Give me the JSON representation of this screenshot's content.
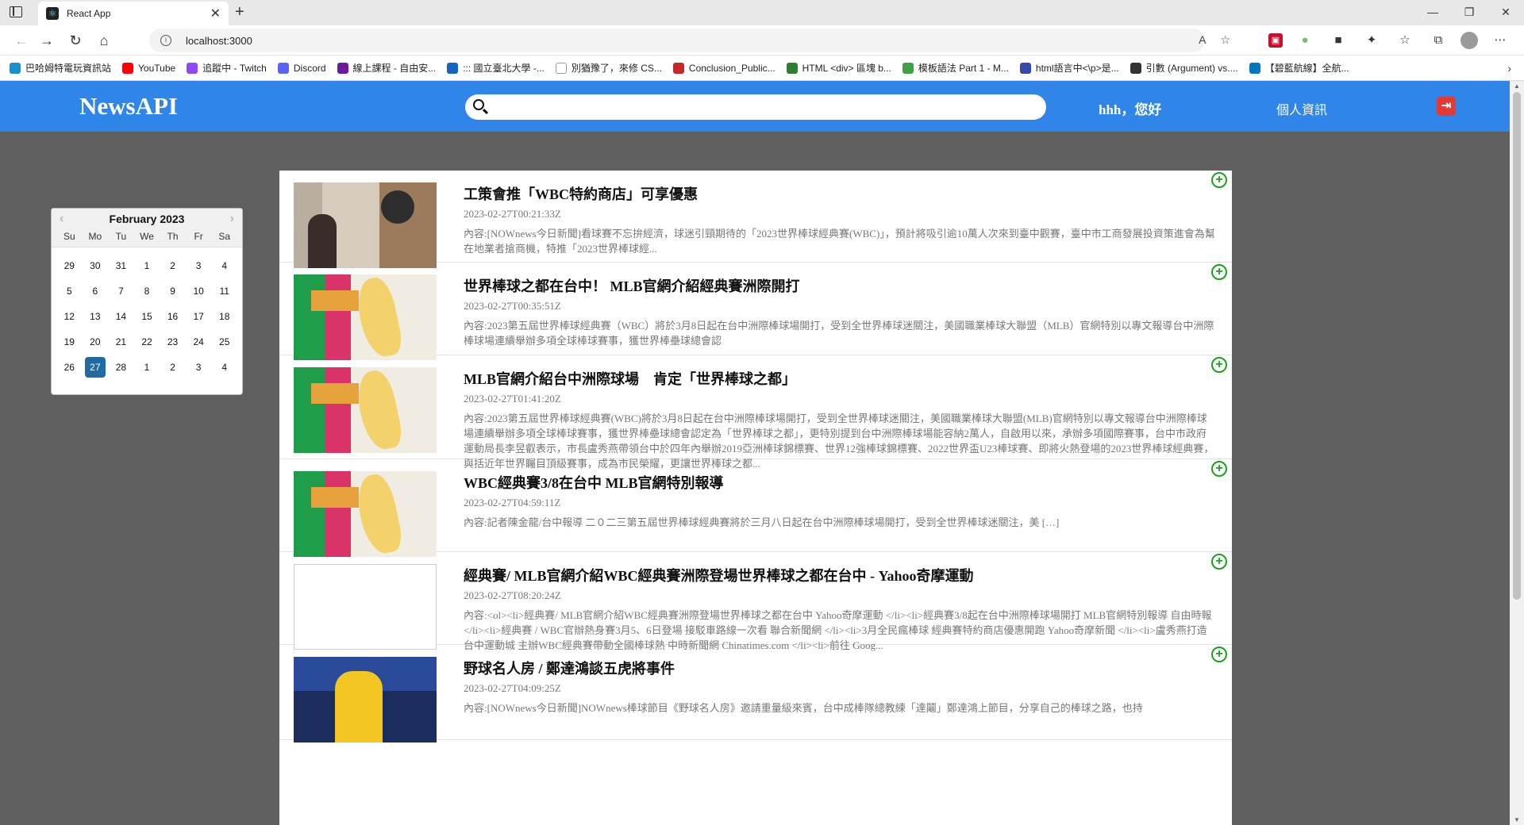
{
  "browser": {
    "tab_title": "React App",
    "url": "localhost:3000",
    "bookmarks": [
      {
        "label": "巴哈姆特電玩資訊站",
        "color": "#1a8fc8"
      },
      {
        "label": "YouTube",
        "color": "#ff0000"
      },
      {
        "label": "追蹤中 - Twitch",
        "color": "#9146ff"
      },
      {
        "label": "Discord",
        "color": "#5865f2"
      },
      {
        "label": "線上課程 - 自由安...",
        "color": "#6a1b9a"
      },
      {
        "label": "::: 國立臺北大學 -...",
        "color": "#1565c0"
      },
      {
        "label": "別猶豫了，來修 CS...",
        "color": "#ffffff"
      },
      {
        "label": "Conclusion_Public...",
        "color": "#c62828"
      },
      {
        "label": "HTML <div> 區塊 b...",
        "color": "#2e7d32"
      },
      {
        "label": "模板語法 Part 1 - M...",
        "color": "#43a047"
      },
      {
        "label": "html語言中<\\p>是...",
        "color": "#3949ab"
      },
      {
        "label": "引數 (Argument) vs....",
        "color": "#333333"
      },
      {
        "label": "【碧藍航線】全航...",
        "color": "#0277bd"
      }
    ]
  },
  "header": {
    "brand": "NewsAPI",
    "search_placeholder": "",
    "greeting": "hhh，您好",
    "profile_link": "個人資訊"
  },
  "calendar": {
    "month_label": "February 2023",
    "weekdays": [
      "Su",
      "Mo",
      "Tu",
      "We",
      "Th",
      "Fr",
      "Sa"
    ],
    "days": [
      "29",
      "30",
      "31",
      "1",
      "2",
      "3",
      "4",
      "5",
      "6",
      "7",
      "8",
      "9",
      "10",
      "11",
      "12",
      "13",
      "14",
      "15",
      "16",
      "17",
      "18",
      "19",
      "20",
      "21",
      "22",
      "23",
      "24",
      "25",
      "26",
      "27",
      "28",
      "1",
      "2",
      "3",
      "4"
    ],
    "selected": "27"
  },
  "articles": [
    {
      "title": "工策會推「WBC特約商店」可享優惠",
      "date": "2023-02-27T00:21:33Z",
      "description": "內容:[NOWnews今日新聞]看球賽不忘拚經濟，球迷引頸期待的「2023世界棒球經典賽(WBC)」，預計將吸引逾10萬人次來到臺中觀賽，臺中市工商發展投資策進會為幫在地業者搶商機，特推「2023世界棒球經...",
      "image": "shop"
    },
    {
      "title": "世界棒球之都在台中！ MLB官網介紹經典賽洲際開打",
      "date": "2023-02-27T00:35:51Z",
      "description": "內容:2023第五屆世界棒球經典賽（WBC）將於3月8日起在台中洲際棒球場開打，受到全世界棒球迷關注，美國職業棒球大聯盟（MLB）官網特別以專文報導台中洲際棒球場連續舉辦多項全球棒球賽事，獲世界棒壘球總會認",
      "image": "map"
    },
    {
      "title": "MLB官網介紹台中洲際球場　肯定「世界棒球之都」",
      "date": "2023-02-27T01:41:20Z",
      "description": "內容:2023第五屆世界棒球經典賽(WBC)將於3月8日起在台中洲際棒球場開打，受到全世界棒球迷關注，美國職業棒球大聯盟(MLB)官網特別以專文報導台中洲際棒球場連續舉辦多項全球棒球賽事，獲世界棒壘球總會認定為「世界棒球之都」，更特別提到台中洲際棒球場能容納2萬人，自啟用以來，承辦多項國際賽事，台中市政府運動局長李昱叡表示，市長盧秀燕帶領台中於四年內舉辦2019亞洲棒球錦標賽、世界12強棒球錦標賽、2022世界盃U23棒球賽、即將火熱登場的2023世界棒球經典賽，與括近年世界矚目頂級賽事，成為市民榮耀，更讓世界棒球之都...",
      "image": "map"
    },
    {
      "title": "WBC經典賽3/8在台中 MLB官網特別報導",
      "date": "2023-02-27T04:59:11Z",
      "description": "內容:記者陳金龍/台中報導 二０二三第五屆世界棒球經典賽將於三月八日起在台中洲際棒球場開打，受到全世界棒球迷關注，美 […]",
      "image": "map"
    },
    {
      "title": "經典賽/ MLB官網介紹WBC經典賽洲際登場世界棒球之都在台中 - Yahoo奇摩運動",
      "date": "2023-02-27T08:20:24Z",
      "description": "內容:<ol><li>經典賽/ MLB官網介紹WBC經典賽洲際登場世界棒球之都在台中  Yahoo奇摩運動 </li><li>經典賽3/8起在台中洲際棒球場開打 MLB官網特別報導  自由時報 </li><li>經典賽 / WBC官辦熱身賽3月5、6日登場 接駁車路線一次看  聯合新聞網 </li><li>3月全民瘋棒球 經典賽特約商店優惠開跑  Yahoo奇摩新聞 </li><li>盧秀燕打造台中運動城 主辦WBC經典賽帶動全國棒球熱  中時新聞網 Chinatimes.com </li><li>前往 Goog...",
      "image": "blank"
    },
    {
      "title": "野球名人房 / 鄭達鴻談五虎將事件",
      "date": "2023-02-27T04:09:25Z",
      "description": "內容:[NOWnews今日新聞]NOWnews棒球節目《野球名人房》邀請重量級來賓，台中成棒隊總教練「達鬮」鄭達鴻上節目，分享自己的棒球之路，也持",
      "image": "player"
    }
  ]
}
